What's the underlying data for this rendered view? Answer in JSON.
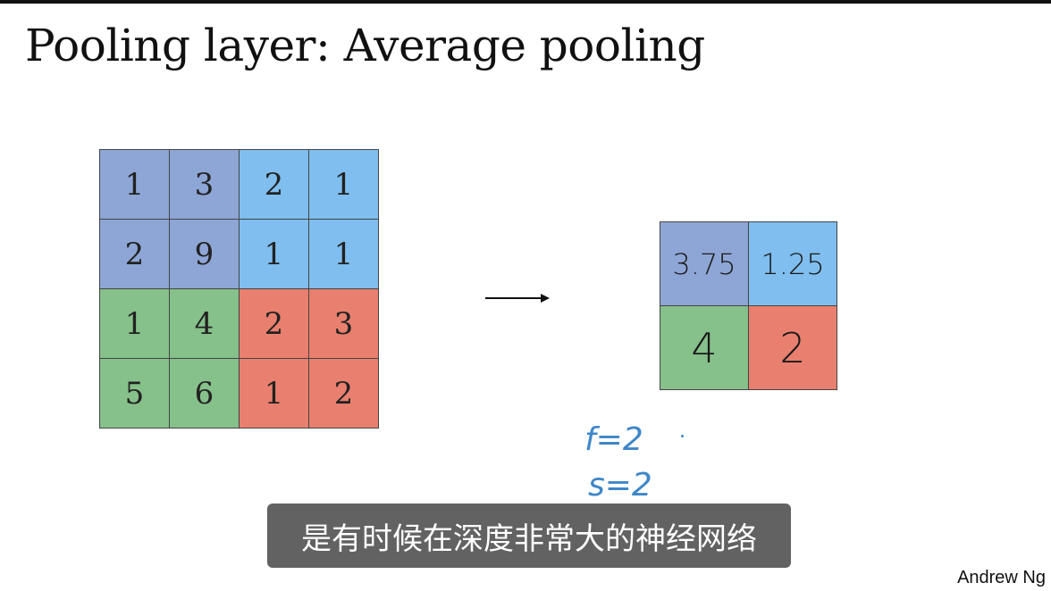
{
  "slide": {
    "title": "Pooling layer: Average pooling",
    "author": "Andrew Ng"
  },
  "input_matrix": {
    "rows": [
      [
        "1",
        "3",
        "2",
        "1"
      ],
      [
        "2",
        "9",
        "1",
        "1"
      ],
      [
        "1",
        "4",
        "2",
        "3"
      ],
      [
        "5",
        "6",
        "1",
        "2"
      ]
    ]
  },
  "output_matrix": {
    "rows": [
      [
        "3.75",
        "1.25"
      ],
      [
        "4",
        "2"
      ]
    ]
  },
  "annotations": {
    "f_label": "f=2",
    "s_label": "s=2"
  },
  "subtitle": {
    "text": "是有时候在深度非常大的神经网络"
  },
  "colors": {
    "quadrant_top_left": "#8ea6d6",
    "quadrant_top_right": "#7fbeee",
    "quadrant_bottom_left": "#86c08a",
    "quadrant_bottom_right": "#e9806f",
    "handwriting": "#3d86c8"
  },
  "icons": {
    "arrow": "right-arrow-icon"
  }
}
